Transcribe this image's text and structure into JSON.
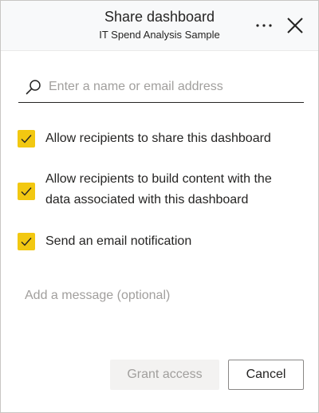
{
  "header": {
    "title": "Share dashboard",
    "subtitle": "IT Spend Analysis Sample",
    "more_icon": "ellipsis-icon",
    "close_icon": "close-icon"
  },
  "search": {
    "placeholder": "Enter a name or email address",
    "icon": "search-icon"
  },
  "options": [
    {
      "checked": true,
      "line1": "Allow recipients to share this dashboard",
      "line2": ""
    },
    {
      "checked": true,
      "line1": "Allow recipients to build content with the",
      "line2": "data associated with this dashboard"
    },
    {
      "checked": true,
      "line1": "Send an email notification",
      "line2": ""
    }
  ],
  "message": {
    "placeholder": "Add a message (optional)"
  },
  "buttons": {
    "grant": "Grant access",
    "cancel": "Cancel"
  },
  "colors": {
    "accent": "#F2C811",
    "header_bg": "#F8F9FA",
    "disabled_bg": "#F3F2F1"
  }
}
